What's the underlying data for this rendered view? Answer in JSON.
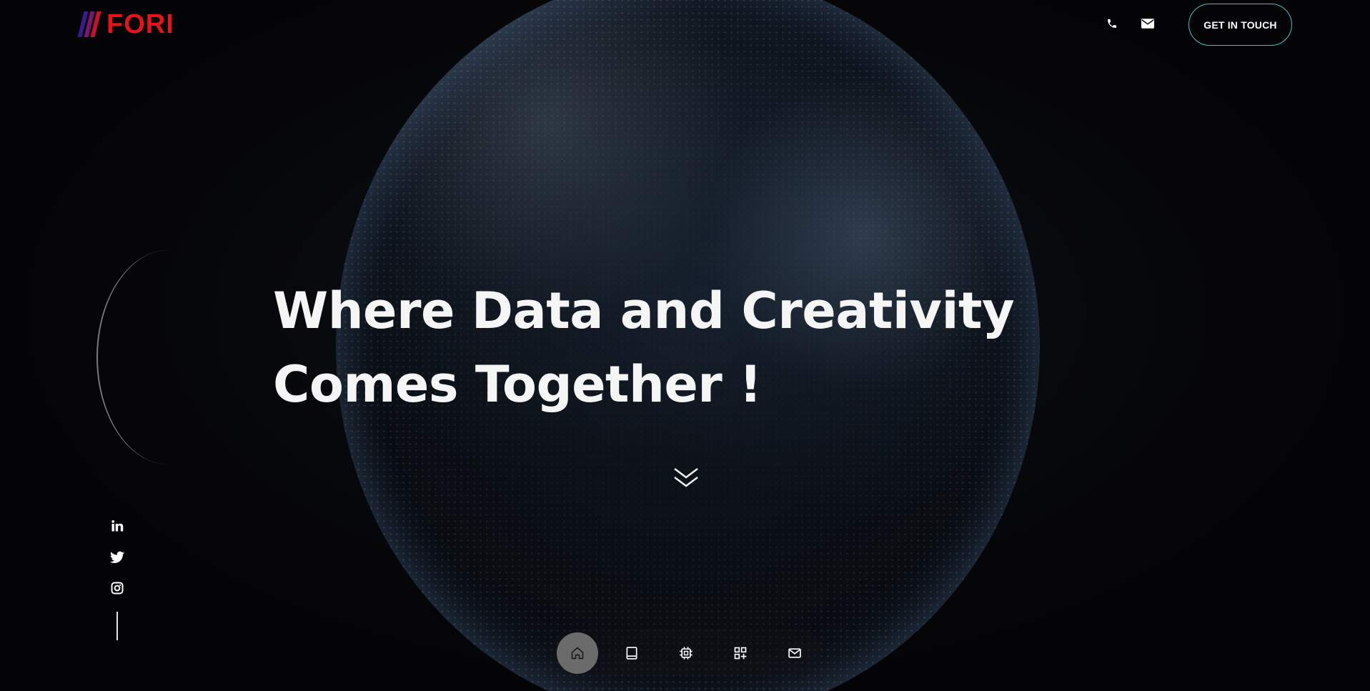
{
  "header": {
    "logo_text": "FORI",
    "logo_icon": "striped-logo-mark",
    "phone_icon": "phone-icon",
    "email_icon": "email-icon",
    "cta_label": "GET IN TOUCH"
  },
  "hero": {
    "title": "Where Data and Creativity Comes Together !",
    "background": "dotted-earth-globe",
    "scroll_icon": "double-chevron-down-icon"
  },
  "socials": [
    {
      "icon": "linkedin-icon"
    },
    {
      "icon": "twitter-icon"
    },
    {
      "icon": "instagram-icon"
    }
  ],
  "bottom_nav": {
    "items": [
      {
        "icon": "home-icon",
        "active": true
      },
      {
        "icon": "book-icon",
        "active": false
      },
      {
        "icon": "chip-icon",
        "active": false
      },
      {
        "icon": "grid-plus-icon",
        "active": false
      },
      {
        "icon": "mail-icon",
        "active": false
      }
    ]
  },
  "colors": {
    "brand_red": "#e4141b",
    "logo_stripe_1": "#3b1a8c",
    "logo_stripe_2": "#7a1670",
    "logo_stripe_3": "#c21230",
    "cta_border": "#3ec8c4",
    "background": "#050406",
    "active_nav": "#6b6b6b"
  }
}
